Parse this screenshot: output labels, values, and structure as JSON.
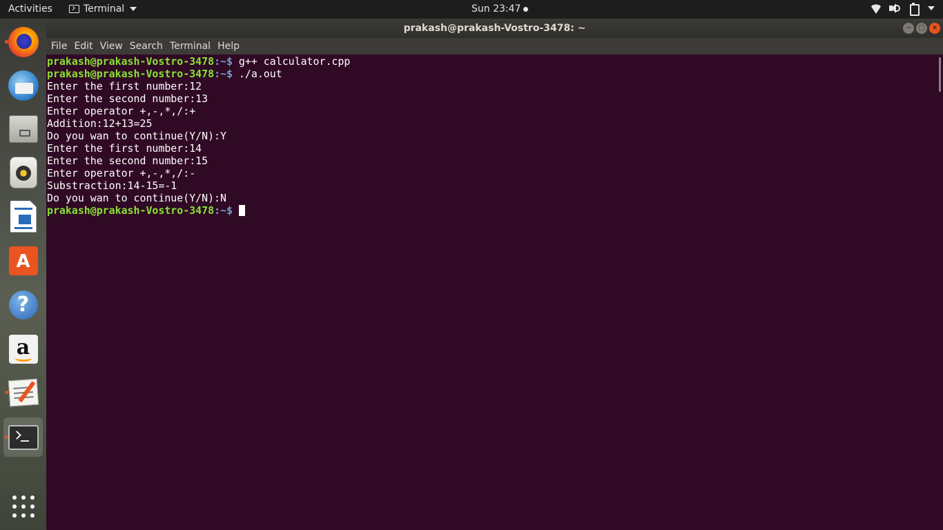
{
  "topbar": {
    "activities": "Activities",
    "app_name": "Terminal",
    "clock": "Sun 23:47"
  },
  "dock": {
    "items": [
      {
        "name": "firefox",
        "icon": "firefox-icon",
        "running": true
      },
      {
        "name": "thunderbird",
        "icon": "thunderbird-icon",
        "running": false
      },
      {
        "name": "files",
        "icon": "files-icon",
        "running": false
      },
      {
        "name": "rhythmbox",
        "icon": "rhythmbox-icon",
        "running": false
      },
      {
        "name": "libreoffice-writer",
        "icon": "writer-icon",
        "running": false
      },
      {
        "name": "software-center",
        "icon": "store-icon",
        "running": false
      },
      {
        "name": "help",
        "icon": "help-icon",
        "running": false
      },
      {
        "name": "amazon",
        "icon": "amazon-icon",
        "running": false
      },
      {
        "name": "text-editor",
        "icon": "text-editor-icon",
        "running": true
      },
      {
        "name": "terminal",
        "icon": "terminal-icon",
        "running": true,
        "active": true
      }
    ],
    "show_apps_icon": "show-apps-grid-icon",
    "running_dot_color": "#e95420"
  },
  "window": {
    "title": "prakash@prakash-Vostro-3478: ~",
    "menu": [
      "File",
      "Edit",
      "View",
      "Search",
      "Terminal",
      "Help"
    ],
    "buttons": {
      "minimize": "−",
      "maximize": "□",
      "close": "×"
    }
  },
  "terminal": {
    "background": "#300a24",
    "prompt_user": "prakash@prakash-Vostro-3478",
    "prompt_path": ":~$",
    "lines": [
      {
        "type": "prompt",
        "cmd": " g++ calculator.cpp"
      },
      {
        "type": "prompt",
        "cmd": " ./a.out"
      },
      {
        "type": "out",
        "text": "Enter the first number:12"
      },
      {
        "type": "out",
        "text": "Enter the second number:13"
      },
      {
        "type": "out",
        "text": "Enter operator +,-,*,/:+"
      },
      {
        "type": "out",
        "text": "Addition:12+13=25"
      },
      {
        "type": "out",
        "text": "Do you wan to continue(Y/N):Y"
      },
      {
        "type": "out",
        "text": "Enter the first number:14"
      },
      {
        "type": "out",
        "text": "Enter the second number:15"
      },
      {
        "type": "out",
        "text": "Enter operator +,-,*,/:-"
      },
      {
        "type": "out",
        "text": "Substraction:14-15=-1"
      },
      {
        "type": "out",
        "text": "Do you wan to continue(Y/N):N"
      },
      {
        "type": "prompt",
        "cmd": " ",
        "cursor": true
      }
    ]
  }
}
